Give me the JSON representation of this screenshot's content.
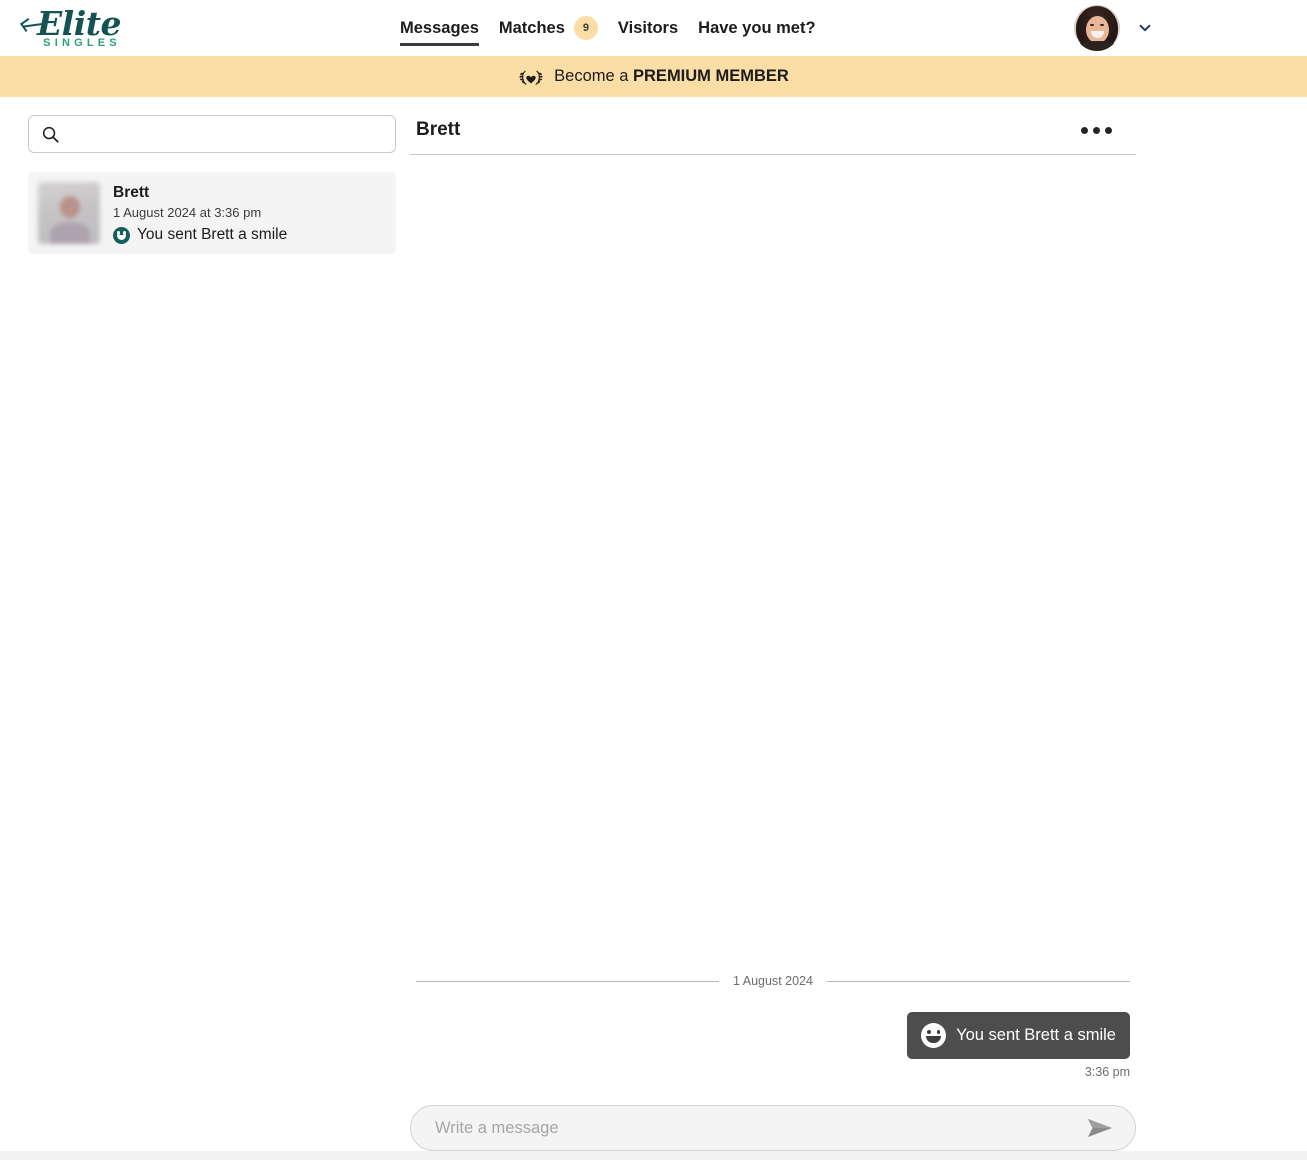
{
  "brand": {
    "name": "Elite",
    "tagline": "SINGLES",
    "primary_color": "#135453",
    "accent_color": "#2e9e7e"
  },
  "header": {
    "nav": [
      {
        "label": "Messages",
        "active": true,
        "badge": null
      },
      {
        "label": "Matches",
        "active": false,
        "badge": "9"
      },
      {
        "label": "Visitors",
        "active": false,
        "badge": null
      },
      {
        "label": "Have you met?",
        "active": false,
        "badge": null
      }
    ],
    "avatar_alt": "user-avatar",
    "chevron_icon": "chevron-down-icon"
  },
  "banner": {
    "icon": "laurel-heart-icon",
    "prefix": "Become a ",
    "emphasis": "PREMIUM MEMBER",
    "background_color": "#fbdda6"
  },
  "sidebar": {
    "search": {
      "icon": "search-icon",
      "value": "",
      "placeholder": ""
    },
    "conversations": [
      {
        "name": "Brett",
        "timestamp": "1 August 2024 at 3:36 pm",
        "preview_icon": "smile-icon",
        "preview": "You sent Brett a smile",
        "selected": true
      }
    ]
  },
  "chat": {
    "title": "Brett",
    "menu_icon": "more-options-icon",
    "date_separator": "1 August 2024",
    "messages": [
      {
        "icon": "smile-icon",
        "text": "You sent Brett a smile",
        "time": "3:36 pm",
        "direction": "outgoing",
        "bubble_color": "#4d4d4d"
      }
    ],
    "composer": {
      "value": "",
      "placeholder": "Write a message",
      "send_icon": "send-icon"
    }
  }
}
